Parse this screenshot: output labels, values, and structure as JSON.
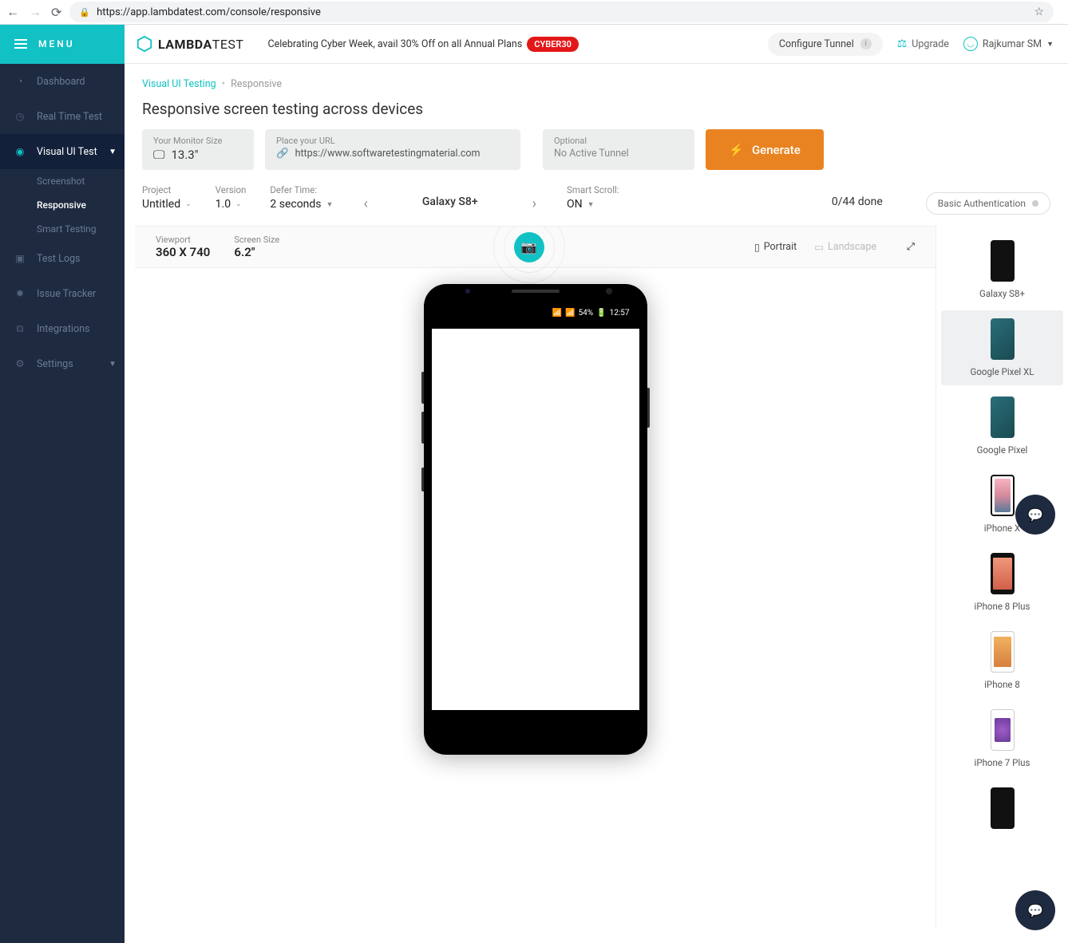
{
  "browser": {
    "url": "https://app.lambdatest.com/console/responsive"
  },
  "topbar": {
    "menu": "MENU",
    "logo_bold": "LAMBDA",
    "logo_thin": "TEST",
    "promo_text": "Celebrating Cyber Week, avail 30% Off on all Annual Plans",
    "promo_code": "CYBER30",
    "tunnel": "Configure Tunnel",
    "upgrade": "Upgrade",
    "user": "Rajkumar SM"
  },
  "sidebar": {
    "items": [
      {
        "label": "Dashboard"
      },
      {
        "label": "Real Time Test"
      },
      {
        "label": "Visual UI Test"
      },
      {
        "label": "Test Logs"
      },
      {
        "label": "Issue Tracker"
      },
      {
        "label": "Integrations"
      },
      {
        "label": "Settings"
      }
    ],
    "subitems": [
      {
        "label": "Screenshot"
      },
      {
        "label": "Responsive"
      },
      {
        "label": "Smart Testing"
      }
    ]
  },
  "breadcrumb": {
    "link": "Visual UI Testing",
    "current": "Responsive"
  },
  "page_title": "Responsive screen testing across devices",
  "config": {
    "monitor_label": "Your Monitor Size",
    "monitor_value": "13.3\"",
    "url_label": "Place your URL",
    "url_value": "https://www.softwaretestingmaterial.com",
    "tunnel_label": "Optional",
    "tunnel_value": "No Active Tunnel",
    "generate": "Generate"
  },
  "settings": {
    "project_label": "Project",
    "project_value": "Untitled",
    "version_label": "Version",
    "version_value": "1.0",
    "defer_label": "Defer Time:",
    "defer_value": "2 seconds",
    "device_name": "Galaxy S8+",
    "scroll_label": "Smart Scroll:",
    "scroll_value": "ON",
    "done": "0/44 done",
    "basic_auth": "Basic Authentication"
  },
  "preview": {
    "viewport_label": "Viewport",
    "viewport_value": "360 X 740",
    "screen_label": "Screen Size",
    "screen_value": "6.2\"",
    "portrait": "Portrait",
    "landscape": "Landscape",
    "status_battery": "54%",
    "status_time": "12:57"
  },
  "devices": [
    {
      "label": "Galaxy S8+",
      "cls": "s8"
    },
    {
      "label": "Google Pixel XL",
      "cls": "pixel"
    },
    {
      "label": "Google Pixel",
      "cls": "pixel"
    },
    {
      "label": "iPhone X",
      "cls": "iphx"
    },
    {
      "label": "iPhone 8 Plus",
      "cls": "iph8p"
    },
    {
      "label": "iPhone 8",
      "cls": "iph8"
    },
    {
      "label": "iPhone 7 Plus",
      "cls": "iph7p"
    }
  ]
}
